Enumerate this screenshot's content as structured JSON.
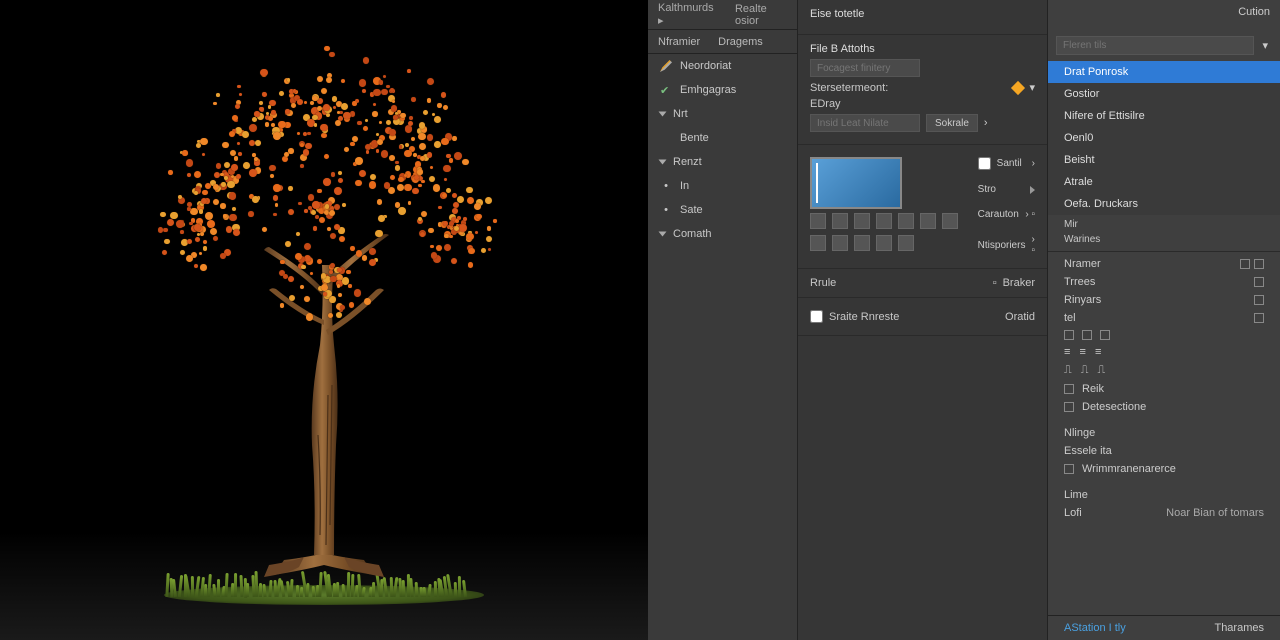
{
  "topbar": {
    "left": "Kalthmurds ▸",
    "right": "Realte osior",
    "corner": "Cution"
  },
  "tabs": {
    "a": "Nframier",
    "b": "Dragems"
  },
  "sidebar": {
    "items": [
      {
        "icon": "pencil",
        "label": "Neordoriat"
      },
      {
        "icon": "check",
        "label": "Emhgagras"
      },
      {
        "icon": "chev",
        "label": "Nrt"
      },
      {
        "icon": "",
        "label": "Bente"
      },
      {
        "icon": "chev",
        "label": "Renzt"
      },
      {
        "icon": "dot",
        "label": "In"
      },
      {
        "icon": "dot",
        "label": "Sate"
      },
      {
        "icon": "chev",
        "label": "Comath"
      }
    ]
  },
  "panel1": {
    "title": "Eise totetle",
    "sec1": "File B Attoths",
    "field1_ph": "Focagest finitery",
    "sec2": "Stersetermeont:",
    "sec3": "EDray",
    "field2_ph": "Insid Leat Nilate",
    "btn1": "Sokrale"
  },
  "panel2": {
    "row1": "Santil",
    "row2": "Stro",
    "row3": "Carauton",
    "row4": "Ntisporiers",
    "row5": "Rrule",
    "row5b": "Braker",
    "chk_label": "Sraite Rnreste",
    "chk2": "Oratid"
  },
  "search": {
    "placeholder": "Fleren tils"
  },
  "menu": {
    "items": [
      "Drat Ponrosk",
      "Gostior",
      "Nifere of Ettisilre",
      "Oenl0",
      "Beisht",
      "Atrale",
      "Oefa. Druckars"
    ],
    "sel": 0,
    "sub1": "Mir",
    "sub2": "Warines",
    "sec_brames": "Nramer",
    "props": [
      "Trrees",
      "Rinyars",
      "tel"
    ],
    "tools": [
      "Reik",
      "Detesectione"
    ],
    "group_h": "Nlinge",
    "group_items": [
      "Essele ita",
      "Wrimmranenarerce"
    ],
    "lone": "Lime",
    "lofi": "Lofi",
    "lofi_r": "Noar Bian of tomars"
  },
  "footer": {
    "left": "AStation I tly",
    "right": "Tharames"
  }
}
